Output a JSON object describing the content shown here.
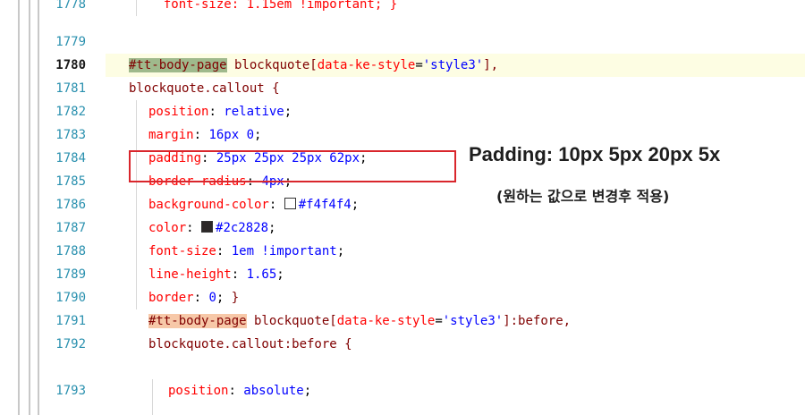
{
  "editor": {
    "active_line": "1780",
    "lines": [
      {
        "no": "1778",
        "text": "  font-size: 1.15em !important; }"
      },
      {
        "no": "1779",
        "text": ""
      },
      {
        "no": "1780",
        "selector_hl": "#tt-body-page",
        "rest": " blockquote[",
        "attr": "data-ke-style",
        "eq": "=",
        "str": "'style3'",
        "end": "],"
      },
      {
        "no": "1781",
        "text": "blockquote.callout {"
      },
      {
        "no": "1782",
        "prop": "position",
        "val": "relative"
      },
      {
        "no": "1783",
        "prop": "margin",
        "val": "16px 0"
      },
      {
        "no": "1784",
        "prop": "padding",
        "val": "25px 25px 25px 62px"
      },
      {
        "no": "1785",
        "prop": "border-radius",
        "val": "4px"
      },
      {
        "no": "1786",
        "prop": "background-color",
        "val": "#f4f4f4",
        "swatch": "#ffffff"
      },
      {
        "no": "1787",
        "prop": "color",
        "val": "#2c2828",
        "swatch": "#2c2828"
      },
      {
        "no": "1788",
        "prop": "font-size",
        "val": "1em !important"
      },
      {
        "no": "1789",
        "prop": "line-height",
        "val": "1.65"
      },
      {
        "no": "1790",
        "prop": "border",
        "val": "0",
        "tail": " }"
      },
      {
        "no": "1791",
        "selector_hl": "#tt-body-page",
        "rest": " blockquote[",
        "attr": "data-ke-style",
        "eq": "=",
        "str": "'style3'",
        "end": "]:before,"
      },
      {
        "no": "1792",
        "text": "blockquote.callout:before {"
      },
      {
        "no": "1793",
        "prop": "position",
        "val": "absolute"
      }
    ]
  },
  "annotation": {
    "title": "Padding: 10px 5px 20px 5x",
    "subtitle": "(원하는 값으로 변경후 적용)"
  },
  "colors": {
    "highlight_box": "#d9262c",
    "line_number": "#2b91af",
    "selector": "#800000",
    "property": "#ff0000",
    "value": "#0000ff"
  }
}
